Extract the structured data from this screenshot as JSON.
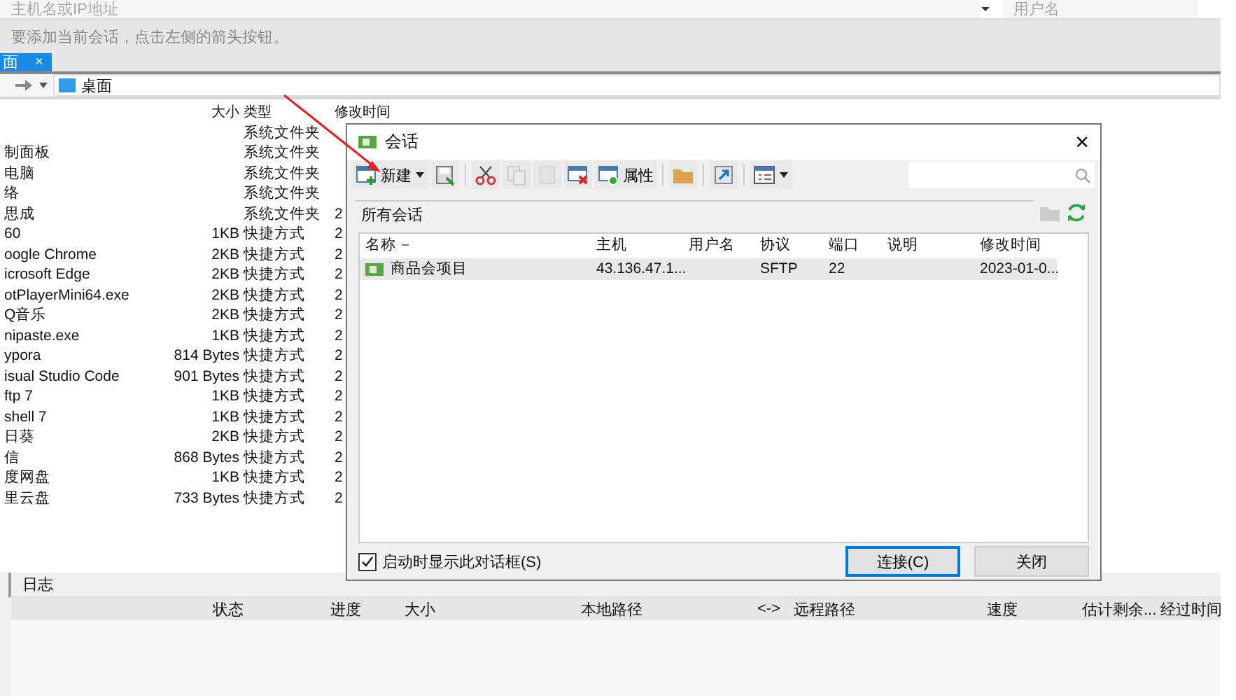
{
  "connection_bar": {
    "host_placeholder": "主机名或IP地址",
    "user_placeholder": "用户名"
  },
  "hint": "要添加当前会话，点击左侧的箭头按钮。",
  "tabs": [
    {
      "label": "面",
      "close": "×",
      "selected": true
    }
  ],
  "path": "桌面",
  "file_list": {
    "columns": [
      "大小",
      "类型",
      "修改时间"
    ],
    "rows": [
      {
        "type": "系统文件夹"
      },
      {
        "name": "制面板",
        "type": "系统文件夹"
      },
      {
        "name": "电脑",
        "type": "系统文件夹"
      },
      {
        "name": "络",
        "type": "系统文件夹"
      },
      {
        "name": "思成",
        "type": "系统文件夹",
        "modified": "2"
      },
      {
        "name": "60",
        "size": "1KB",
        "type": "快捷方式",
        "modified": "2"
      },
      {
        "name": "oogle Chrome",
        "size": "2KB",
        "type": "快捷方式",
        "modified": "2"
      },
      {
        "name": "icrosoft Edge",
        "size": "2KB",
        "type": "快捷方式",
        "modified": "2"
      },
      {
        "name": "otPlayerMini64.exe",
        "size": "2KB",
        "type": "快捷方式",
        "modified": "2"
      },
      {
        "name": "Q音乐",
        "size": "2KB",
        "type": "快捷方式",
        "modified": "2"
      },
      {
        "name": "nipaste.exe",
        "size": "1KB",
        "type": "快捷方式",
        "modified": "2"
      },
      {
        "name": "ypora",
        "size": "814 Bytes",
        "type": "快捷方式",
        "modified": "2"
      },
      {
        "name": "isual Studio Code",
        "size": "901 Bytes",
        "type": "快捷方式",
        "modified": "2"
      },
      {
        "name": "ftp 7",
        "size": "1KB",
        "type": "快捷方式",
        "modified": "2"
      },
      {
        "name": "shell 7",
        "size": "1KB",
        "type": "快捷方式",
        "modified": "2"
      },
      {
        "name": "日葵",
        "size": "2KB",
        "type": "快捷方式",
        "modified": "2"
      },
      {
        "name": "信",
        "size": "868 Bytes",
        "type": "快捷方式",
        "modified": "2"
      },
      {
        "name": "度网盘",
        "size": "1KB",
        "type": "快捷方式",
        "modified": "2"
      },
      {
        "name": "里云盘",
        "size": "733 Bytes",
        "type": "快捷方式",
        "modified": "2"
      }
    ]
  },
  "dialog": {
    "title": "会话",
    "close": "×",
    "toolbar": [
      {
        "kind": "new",
        "label": "新建",
        "menu": true,
        "disabled": false
      },
      {
        "kind": "save",
        "disabled": false
      },
      {
        "kind": "separator"
      },
      {
        "kind": "cut",
        "disabled": false
      },
      {
        "kind": "copy",
        "disabled": true
      },
      {
        "kind": "paste",
        "disabled": true
      },
      {
        "kind": "delete",
        "disabled": false
      },
      {
        "kind": "properties",
        "label": "属性",
        "disabled": false
      },
      {
        "kind": "separator"
      },
      {
        "kind": "folder",
        "disabled": false
      },
      {
        "kind": "separator"
      },
      {
        "kind": "shortcut",
        "disabled": false
      },
      {
        "kind": "separator"
      },
      {
        "kind": "view",
        "menu": true,
        "disabled": false
      }
    ],
    "folder_path": "所有会话",
    "columns": [
      {
        "label": "名称",
        "sorted": true
      },
      {
        "label": "主机",
        "sorted": false
      },
      {
        "label": "用户名",
        "sorted": false
      },
      {
        "label": "协议",
        "sorted": false
      },
      {
        "label": "端口",
        "sorted": false
      },
      {
        "label": "说明",
        "sorted": false
      },
      {
        "label": "修改时间",
        "sorted": false
      }
    ],
    "rows": [
      {
        "name": "商品会项目",
        "host": "43.136.47.1...",
        "protocol": "SFTP",
        "port": "22",
        "modified": "2023-01-0...",
        "selected": true
      }
    ],
    "startup_checkbox": {
      "label": "启动时显示此对话框(S)",
      "checked": true
    },
    "buttons": [
      {
        "label": "连接(C)",
        "default": true
      },
      {
        "label": "关闭",
        "default": false
      }
    ]
  },
  "log": {
    "tab": "日志",
    "columns": [
      "状态",
      "进度",
      "大小",
      "本地路径",
      "<->",
      "远程路径",
      "速度",
      "估计剩余...",
      "经过时间"
    ]
  }
}
